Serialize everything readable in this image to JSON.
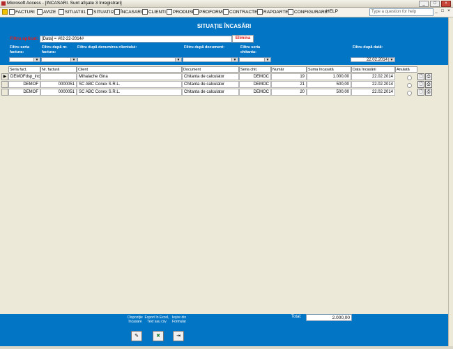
{
  "window": {
    "title": "Microsoft Access - [INCASARI. Sunt afişate 3 înregistrari]",
    "minimize": "_",
    "maximize": "□",
    "close": "×"
  },
  "menu": {
    "items": [
      {
        "label": "FACTURI",
        "icon": "invoice-icon"
      },
      {
        "label": "AVIZE",
        "icon": "avize-icon"
      },
      {
        "label": "SITUATII1",
        "icon": "report-icon"
      },
      {
        "label": "SITUATII2",
        "icon": "report-icon"
      },
      {
        "label": "ÎNCASARI",
        "icon": "cash-icon"
      },
      {
        "label": "CLIENTI",
        "icon": "clients-icon"
      },
      {
        "label": "PRODUSE",
        "icon": "products-icon"
      },
      {
        "label": "PROFORME",
        "icon": "proforma-icon"
      },
      {
        "label": "CONTRACTE",
        "icon": "contract-icon"
      },
      {
        "label": "RAPOARTE",
        "icon": "reports-icon"
      },
      {
        "label": "CONFIGURARE",
        "icon": "config-icon"
      },
      {
        "label": "HELP",
        "icon": ""
      }
    ],
    "help_placeholder": "Type a question for help"
  },
  "header": {
    "title": "SITUAŢIE ÎNCASĂRI"
  },
  "filters": {
    "applied_label": "Filtru aplicat:",
    "applied_value": "[Data] = #02-22-2014#",
    "remove_button": "Elimina",
    "labels": {
      "series": "Filtru seria factura:",
      "number": "Filtru după nr. factura:",
      "client": "Filtru după denumirea clientului:",
      "document": "Filtru după document:",
      "receipt_series": "Filtru seria chitanta:",
      "date": "Filtru după dată:"
    },
    "date_value": "22.02.2014"
  },
  "table": {
    "columns": [
      "Seria fact.",
      "Nr. factură",
      "Client",
      "Document",
      "Seria chit.",
      "Număr",
      "Suma încasată",
      "Data încasării",
      "Anulată"
    ],
    "rows": [
      {
        "series": "DEMOFdsp_inc",
        "number": "",
        "client": "Mihalache Gina",
        "document": "Chitanta de calculator",
        "receipt_series": "DEMOC",
        "receipt_no": "19",
        "amount": "1.000,00",
        "date": "22.02.2014",
        "current": true
      },
      {
        "series": "DEMOF",
        "number": "0000051",
        "client": "SC ABC Conex S.R.L.",
        "document": "Chitanta de calculator",
        "receipt_series": "DEMOC",
        "receipt_no": "21",
        "amount": "500,00",
        "date": "22.02.2014",
        "current": false
      },
      {
        "series": "DEMOF",
        "number": "0000051",
        "client": "SC ABC Conex S.R.L.",
        "document": "Chitanta de calculator",
        "receipt_series": "DEMOC",
        "receipt_no": "20",
        "amount": "500,00",
        "date": "22.02.2014",
        "current": false
      }
    ]
  },
  "footer": {
    "button1_label": "Dispoziţie încasare",
    "button2_label": "Export în Excel, Text sau csv",
    "button3_label": "Ieşire din Formular",
    "total_label": "Total:",
    "total_value": "2.000,00"
  },
  "colors": {
    "panel_blue": "#0275C5",
    "accent_red": "#E31B1B"
  }
}
